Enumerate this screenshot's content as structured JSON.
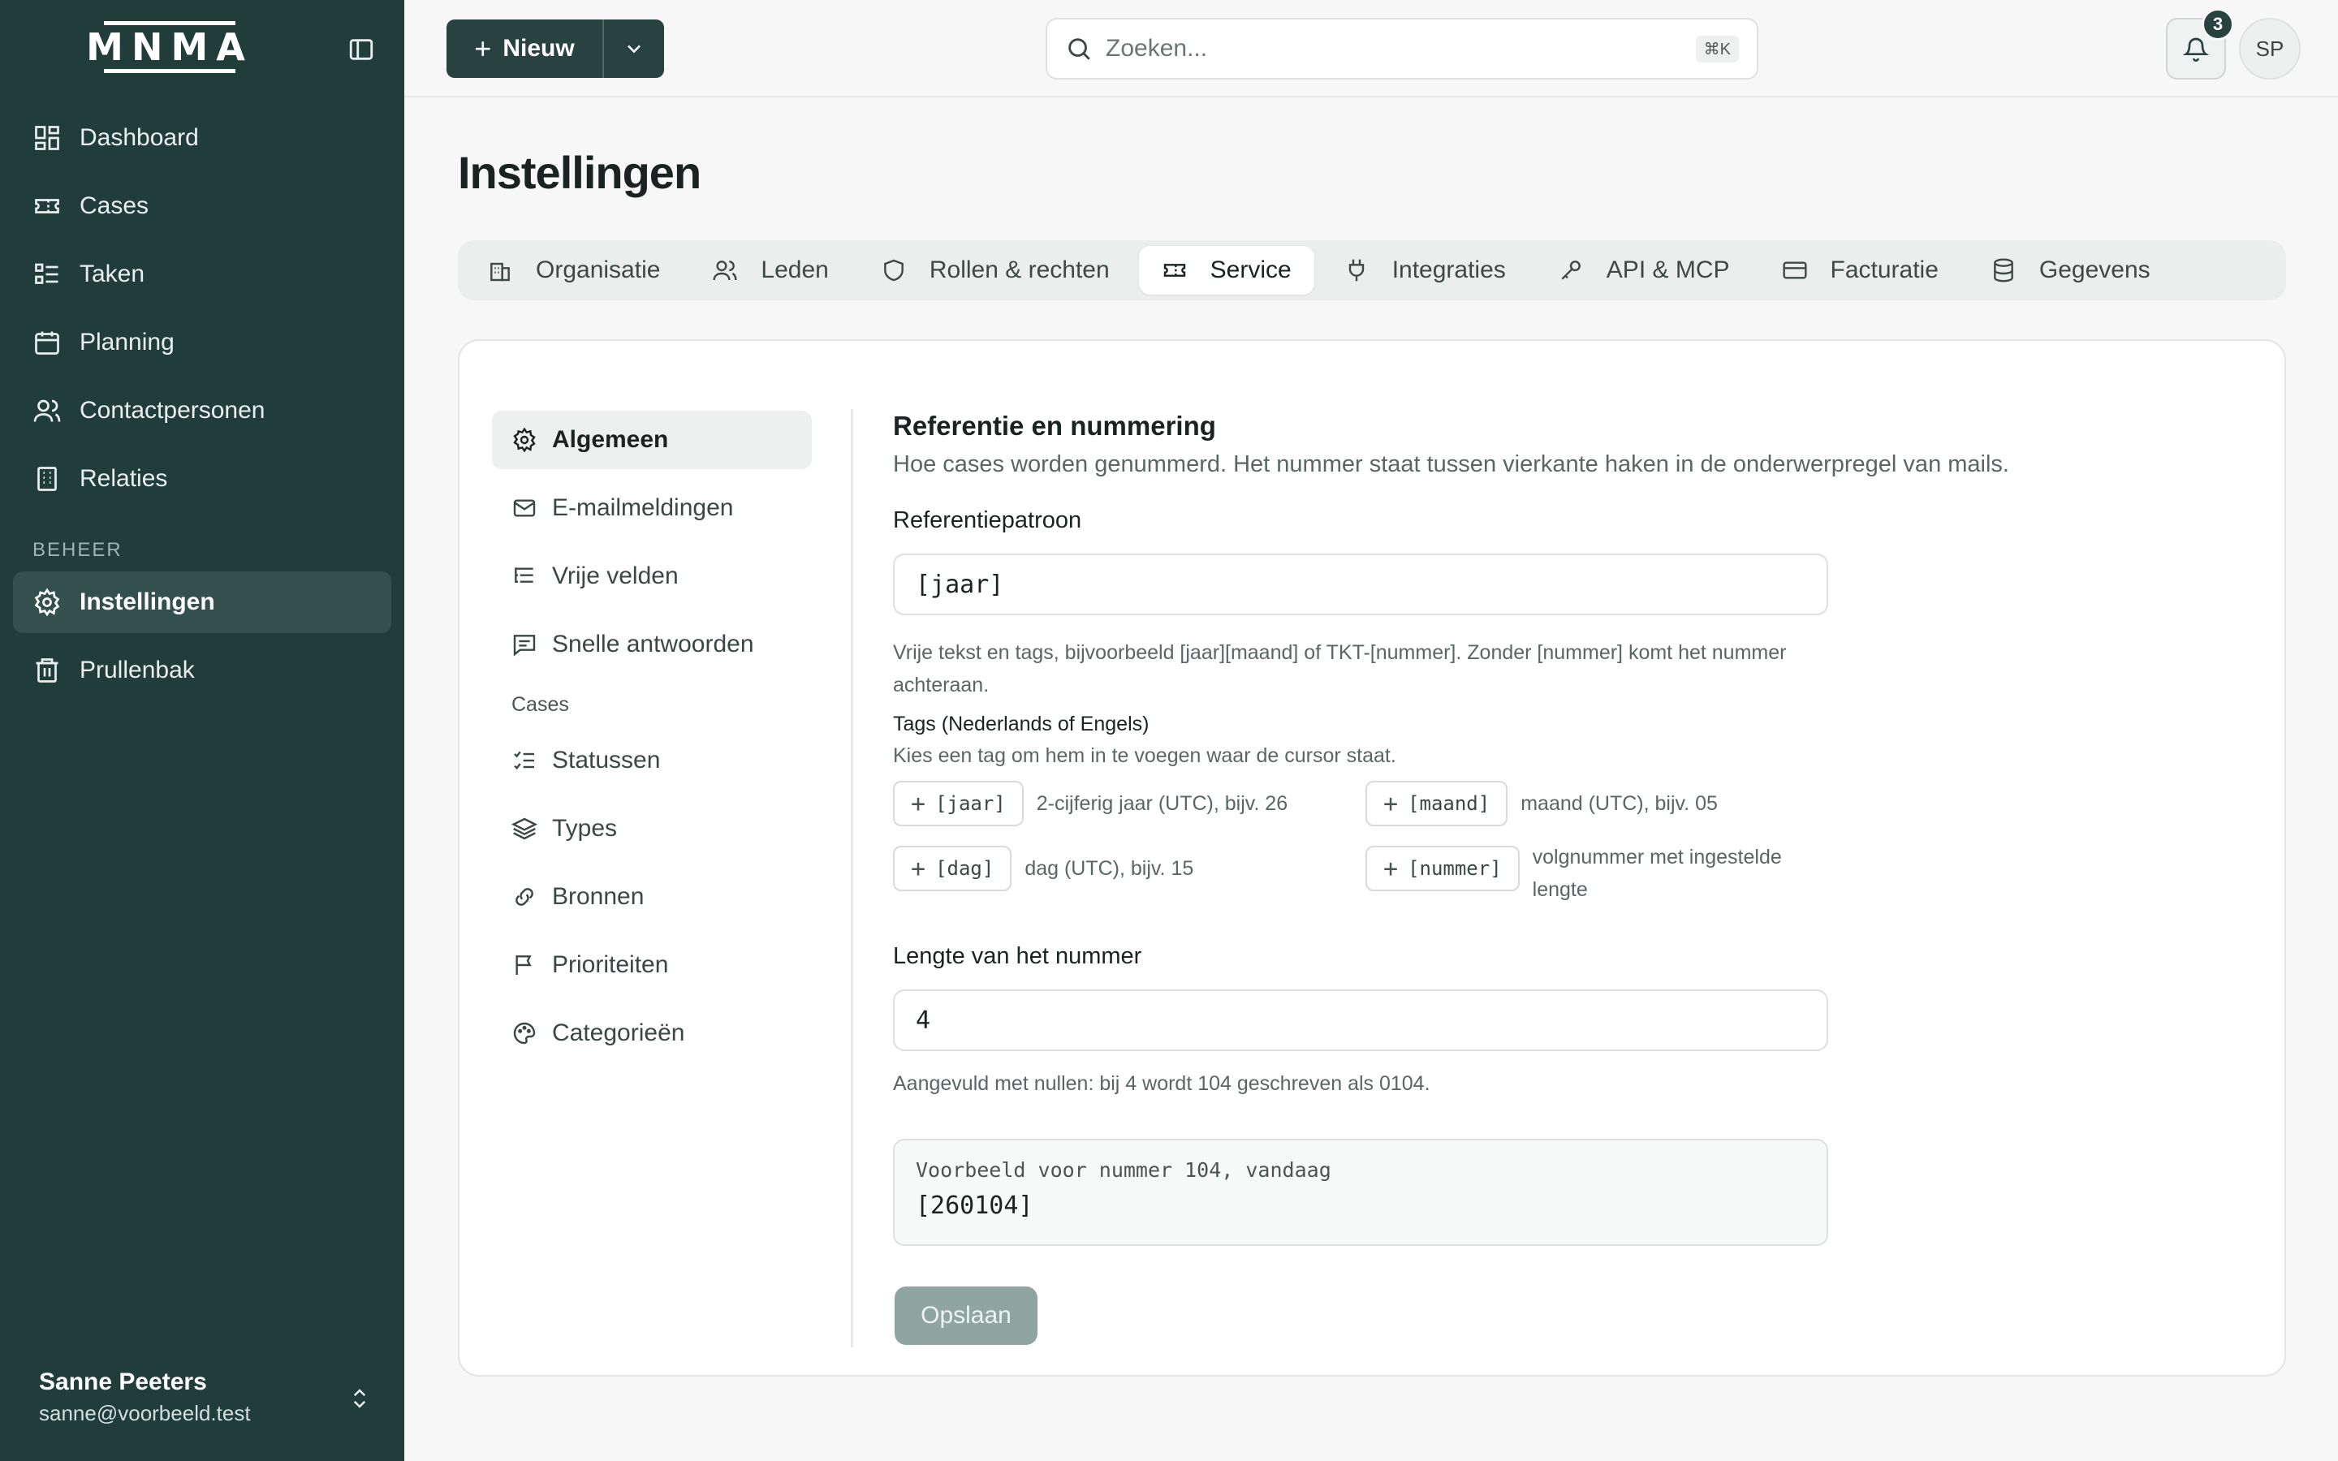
{
  "app": {
    "logo": "MNMA"
  },
  "sidebar": {
    "items": [
      {
        "label": "Dashboard",
        "icon": "dashboard-icon"
      },
      {
        "label": "Cases",
        "icon": "ticket-icon"
      },
      {
        "label": "Taken",
        "icon": "tasks-icon"
      },
      {
        "label": "Planning",
        "icon": "calendar-icon"
      },
      {
        "label": "Contactpersonen",
        "icon": "users-icon"
      },
      {
        "label": "Relaties",
        "icon": "building-icon"
      }
    ],
    "section_label": "BEHEER",
    "admin_items": [
      {
        "label": "Instellingen",
        "icon": "gear-icon",
        "active": true
      },
      {
        "label": "Prullenbak",
        "icon": "trash-icon"
      }
    ],
    "user": {
      "name": "Sanne Peeters",
      "email": "sanne@voorbeeld.test"
    }
  },
  "topbar": {
    "new_label": "Nieuw",
    "search_placeholder": "Zoeken...",
    "search_shortcut": "⌘K",
    "notifications_count": "3",
    "avatar_initials": "SP"
  },
  "page": {
    "title": "Instellingen",
    "tabs": [
      {
        "label": "Organisatie",
        "icon": "building-icon"
      },
      {
        "label": "Leden",
        "icon": "users-icon"
      },
      {
        "label": "Rollen & rechten",
        "icon": "shield-icon"
      },
      {
        "label": "Service",
        "icon": "ticket-icon",
        "active": true
      },
      {
        "label": "Integraties",
        "icon": "plug-icon"
      },
      {
        "label": "API & MCP",
        "icon": "key-icon"
      },
      {
        "label": "Facturatie",
        "icon": "credit-card-icon"
      },
      {
        "label": "Gegevens",
        "icon": "database-icon"
      }
    ]
  },
  "subnav": {
    "items": [
      {
        "label": "Algemeen",
        "icon": "gear-icon",
        "active": true
      },
      {
        "label": "E-mailmeldingen",
        "icon": "mail-icon"
      },
      {
        "label": "Vrije velden",
        "icon": "list-tree-icon"
      },
      {
        "label": "Snelle antwoorden",
        "icon": "message-icon"
      }
    ],
    "section_label": "Cases",
    "case_items": [
      {
        "label": "Statussen",
        "icon": "list-check-icon"
      },
      {
        "label": "Types",
        "icon": "layers-icon"
      },
      {
        "label": "Bronnen",
        "icon": "link-icon"
      },
      {
        "label": "Prioriteiten",
        "icon": "flag-icon"
      },
      {
        "label": "Categorieën",
        "icon": "palette-icon"
      }
    ]
  },
  "form": {
    "title": "Referentie en nummering",
    "description": "Hoe cases worden genummerd. Het nummer staat tussen vierkante haken in de onderwerpregel van mails.",
    "pattern_label": "Referentiepatroon",
    "pattern_value": "[jaar]",
    "pattern_help": "Vrije tekst en tags, bijvoorbeeld [jaar][maand] of TKT-[nummer]. Zonder [nummer] komt het nummer achteraan.",
    "tags_title": "Tags (Nederlands of Engels)",
    "tags_hint": "Kies een tag om hem in te voegen waar de cursor staat.",
    "tags": [
      {
        "tag": "[jaar]",
        "desc": "2-cijferig jaar (UTC), bijv. 26"
      },
      {
        "tag": "[maand]",
        "desc": "maand (UTC), bijv. 05"
      },
      {
        "tag": "[dag]",
        "desc": "dag (UTC), bijv. 15"
      },
      {
        "tag": "[nummer]",
        "desc": "volgnummer met ingestelde lengte"
      }
    ],
    "length_label": "Lengte van het nummer",
    "length_value": "4",
    "length_help": "Aangevuld met nullen: bij 4 wordt 104 geschreven als 0104.",
    "preview_label": "Voorbeeld voor nummer 104, vandaag",
    "preview_value": "[260104]",
    "save_label": "Opslaan"
  },
  "colors": {
    "sidebar_bg": "#213d3a",
    "primary": "#27423f",
    "save_disabled": "#8ea5a1"
  }
}
